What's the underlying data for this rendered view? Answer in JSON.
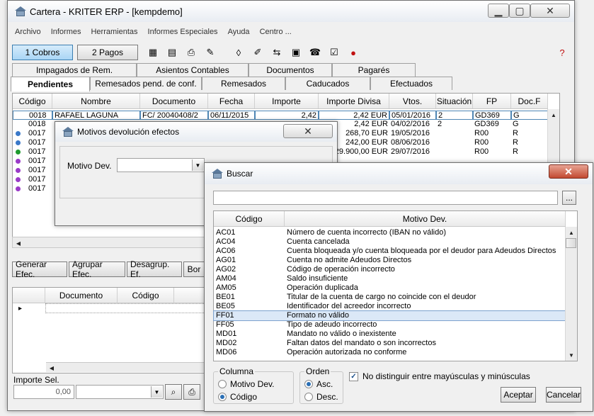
{
  "main": {
    "title": "Cartera - KRITER ERP - [kempdemo]",
    "menu": [
      "Archivo",
      "Informes",
      "Herramientas",
      "Informes Especiales",
      "Ayuda",
      "Centro ..."
    ],
    "toolbar": {
      "cobros_label": "1 Cobros",
      "pagos_label": "2 Pagos"
    },
    "tabs_top": [
      "Impagados de Rem.",
      "Asientos Contables",
      "Documentos",
      "Pagarés"
    ],
    "tabs_bottom": [
      "Pendientes",
      "Remesados pend. de conf.",
      "Remesados",
      "Caducados",
      "Efectuados"
    ],
    "grid": {
      "headers": [
        "Código",
        "Nombre",
        "Documento",
        "Fecha",
        "Importe",
        "Importe Divisa",
        "Vtos.",
        "Situación",
        "FP",
        "Doc.F"
      ],
      "rows": [
        {
          "codigo": "0018",
          "nombre": "RAFAEL LAGUNA",
          "documento": "FC/ 20040408/2",
          "fecha": "06/11/2015",
          "importe": "2,42",
          "divisa": "2,42 EUR",
          "vtos": "05/01/2016",
          "situacion": "2",
          "fp": "GD369",
          "docf": "G",
          "dot": ""
        },
        {
          "codigo": "0018",
          "nombre": "",
          "documento": "",
          "fecha": "",
          "importe": "",
          "divisa": "2,42 EUR",
          "vtos": "04/02/2016",
          "situacion": "2",
          "fp": "GD369",
          "docf": "G",
          "dot": ""
        },
        {
          "codigo": "0017",
          "nombre": "",
          "documento": "",
          "fecha": "",
          "importe": "",
          "divisa": "268,70 EUR",
          "vtos": "19/05/2016",
          "situacion": "",
          "fp": "R00",
          "docf": "R",
          "dot": "#3a78c8"
        },
        {
          "codigo": "0017",
          "nombre": "",
          "documento": "",
          "fecha": "",
          "importe": "",
          "divisa": "242,00 EUR",
          "vtos": "08/06/2016",
          "situacion": "",
          "fp": "R00",
          "docf": "R",
          "dot": "#3a78c8"
        },
        {
          "codigo": "0017",
          "nombre": "",
          "documento": "",
          "fecha": "",
          "importe": "",
          "divisa": "229.900,00 EUR",
          "vtos": "29/07/2016",
          "situacion": "",
          "fp": "R00",
          "docf": "R",
          "dot": "#1e9a2e"
        },
        {
          "codigo": "0017",
          "nombre": "",
          "documento": "",
          "fecha": "",
          "importe": "",
          "divisa": "",
          "vtos": "",
          "situacion": "",
          "fp": "",
          "docf": "",
          "dot": "#9a3ac8"
        },
        {
          "codigo": "0017",
          "nombre": "",
          "documento": "",
          "fecha": "",
          "importe": "",
          "divisa": "",
          "vtos": "",
          "situacion": "",
          "fp": "",
          "docf": "",
          "dot": "#9a3ac8"
        },
        {
          "codigo": "0017",
          "nombre": "",
          "documento": "",
          "fecha": "",
          "importe": "",
          "divisa": "",
          "vtos": "",
          "situacion": "",
          "fp": "",
          "docf": "",
          "dot": "#9a3ac8"
        },
        {
          "codigo": "0017",
          "nombre": "",
          "documento": "",
          "fecha": "",
          "importe": "",
          "divisa": "",
          "vtos": "",
          "situacion": "",
          "fp": "",
          "docf": "",
          "dot": "#9a3ac8"
        }
      ]
    },
    "actions": [
      "Generar Efec.",
      "Agrupar Efec.",
      "Desagrup. Ef.",
      "Bor"
    ],
    "lower_grid": {
      "headers": [
        "Documento",
        "Código"
      ]
    },
    "importe_sel": {
      "label": "Importe Sel.",
      "value": "0,00"
    }
  },
  "motivos": {
    "title": "Motivos devolución efectos",
    "field_label": "Motivo Dev.",
    "field_value": ""
  },
  "buscar": {
    "title": "Buscar",
    "search_value": "",
    "browse_label": "...",
    "headers": [
      "Código",
      "Motivo Dev."
    ],
    "rows": [
      {
        "code": "AC01",
        "desc": "Número de cuenta incorrecto (IBAN no válido)"
      },
      {
        "code": "AC04",
        "desc": "Cuenta cancelada"
      },
      {
        "code": "AC06",
        "desc": "Cuenta bloqueada y/o cuenta bloqueada por el deudor para Adeudos Directos"
      },
      {
        "code": "AG01",
        "desc": "Cuenta no admite Adeudos Directos"
      },
      {
        "code": "AG02",
        "desc": "Código de operación incorrecto"
      },
      {
        "code": "AM04",
        "desc": "Saldo insuficiente"
      },
      {
        "code": "AM05",
        "desc": "Operación duplicada"
      },
      {
        "code": "BE01",
        "desc": "Titular de la cuenta de cargo no coincide con el deudor"
      },
      {
        "code": "BE05",
        "desc": "Identificador del acreedor incorrecto"
      },
      {
        "code": "FF01",
        "desc": "Formato no válido"
      },
      {
        "code": "FF05",
        "desc": "Tipo de adeudo incorrecto"
      },
      {
        "code": "MD01",
        "desc": "Mandato no válido o inexistente"
      },
      {
        "code": "MD02",
        "desc": "Faltan datos del mandato o son incorrectos"
      },
      {
        "code": "MD06",
        "desc": "Operación autorizada no conforme"
      }
    ],
    "selected_index": 9,
    "columna": {
      "label": "Columna",
      "options": [
        "Motivo Dev.",
        "Código"
      ],
      "selected": 1
    },
    "orden": {
      "label": "Orden",
      "options": [
        "Asc.",
        "Desc."
      ],
      "selected": 0
    },
    "case_label": "No distinguir entre mayúsculas y minúsculas",
    "case_checked": true,
    "accept_label": "Aceptar",
    "cancel_label": "Cancelar"
  }
}
